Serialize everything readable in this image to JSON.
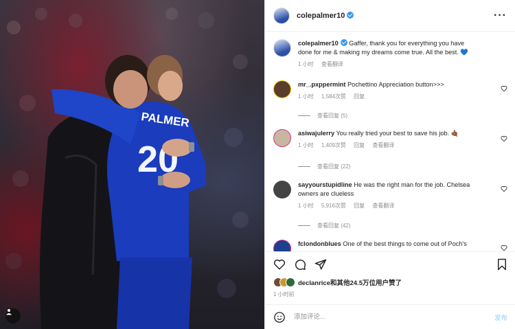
{
  "header": {
    "username": "colepalmer10",
    "more_icon": "more-horizontal-icon"
  },
  "caption": {
    "username": "colepalmer10",
    "text": "Gaffer, thank you for everything you have done for me & making my dreams come true. All the best. 💙",
    "time": "1 小时",
    "translate": "查看翻译"
  },
  "comments": [
    {
      "username": "mr_.pxppermint",
      "text": "Pochettino Appreciation button>>>",
      "time": "1 小时",
      "likes": "1,584次赞",
      "reply": "回复",
      "translate": "",
      "replies": "查看回复 (5)",
      "avatar_color": "#5a3e2b"
    },
    {
      "username": "asiwajulerry",
      "text": "You really tried your best to save his job. 🤙🏾",
      "time": "1 小时",
      "likes": "1,409次赞",
      "reply": "回复",
      "translate": "查看翻译",
      "replies": "查看回复 (22)",
      "avatar_color": "#c8b6a0"
    },
    {
      "username": "sayyourstupidline",
      "text": "He was the right man for the job. Chelsea owners are clueless",
      "time": "1 小时",
      "likes": "5,916次赞",
      "reply": "回复",
      "translate": "查看翻译",
      "replies": "查看回复 (42)",
      "avatar_color": "#444444"
    },
    {
      "username": "fclondonblues",
      "text": "One of the best things to come out of Poch's",
      "avatar_color": "#1d3f8f"
    }
  ],
  "actions": {
    "like_icon": "heart-icon",
    "comment_icon": "comment-icon",
    "share_icon": "send-icon",
    "save_icon": "bookmark-icon"
  },
  "likes": {
    "user": "declanrice",
    "text": "和其他24.5万位用户赞了"
  },
  "post_time": "1 小时前",
  "composer": {
    "emoji_icon": "emoji-icon",
    "placeholder": "添加评论...",
    "post_label": "发布"
  },
  "photo": {
    "tag_icon": "person-tag-icon"
  },
  "colors": {
    "verified": "#3897f0",
    "secondary_text": "#8e8e8e",
    "post_button": "#b2dffc",
    "heart_emoji": "#3c8ae8"
  }
}
